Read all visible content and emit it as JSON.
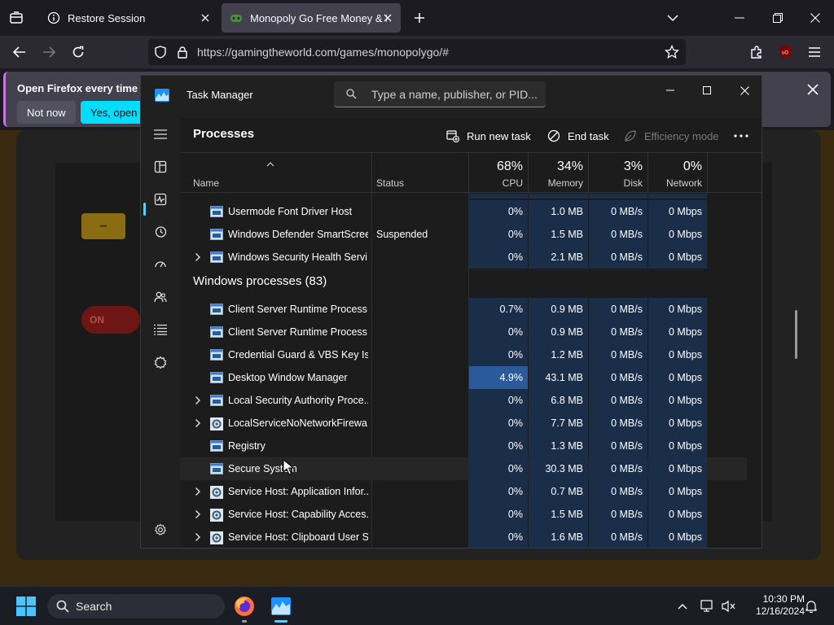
{
  "browser": {
    "tabs": [
      {
        "title": "Restore Session",
        "active": false
      },
      {
        "title": "Monopoly Go Free Money & R",
        "active": true
      }
    ],
    "url": "https://gamingtheworld.com/games/monopolygo/#",
    "notification": {
      "text": "Open Firefox every time yo",
      "not_now": "Not now",
      "yes_open": "Yes, open Fi"
    }
  },
  "page": {
    "minus_label": "–",
    "on_label": "ON"
  },
  "task_manager": {
    "title": "Task Manager",
    "search_placeholder": "Type a name, publisher, or PID...",
    "section_title": "Processes",
    "toolbar": {
      "run_new_task": "Run new task",
      "end_task": "End task",
      "efficiency_mode": "Efficiency mode"
    },
    "columns": {
      "name": "Name",
      "status": "Status",
      "cpu": {
        "pct": "68%",
        "label": "CPU"
      },
      "memory": {
        "pct": "34%",
        "label": "Memory"
      },
      "disk": {
        "pct": "3%",
        "label": "Disk"
      },
      "network": {
        "pct": "0%",
        "label": "Network"
      }
    },
    "top_rows": [
      {
        "name": "Usermode Font Driver Host",
        "status": "",
        "cpu": "0%",
        "memory": "1.0 MB",
        "disk": "0 MB/s",
        "network": "0 Mbps",
        "expandable": false,
        "icon": "window-icon"
      },
      {
        "name": "Windows Defender SmartScreen",
        "status": "Suspended",
        "cpu": "0%",
        "memory": "1.5 MB",
        "disk": "0 MB/s",
        "network": "0 Mbps",
        "expandable": false,
        "icon": "window-icon"
      },
      {
        "name": "Windows Security Health Servi...",
        "status": "",
        "cpu": "0%",
        "memory": "2.1 MB",
        "disk": "0 MB/s",
        "network": "0 Mbps",
        "expandable": true,
        "icon": "window-icon"
      }
    ],
    "group_title": "Windows processes (83)",
    "windows_rows": [
      {
        "name": "Client Server Runtime Process",
        "status": "",
        "cpu": "0.7%",
        "memory": "0.9 MB",
        "disk": "0 MB/s",
        "network": "0 Mbps",
        "expandable": false,
        "icon": "window-icon"
      },
      {
        "name": "Client Server Runtime Process",
        "status": "",
        "cpu": "0%",
        "memory": "0.9 MB",
        "disk": "0 MB/s",
        "network": "0 Mbps",
        "expandable": false,
        "icon": "window-icon"
      },
      {
        "name": "Credential Guard & VBS Key Is...",
        "status": "",
        "cpu": "0%",
        "memory": "1.2 MB",
        "disk": "0 MB/s",
        "network": "0 Mbps",
        "expandable": false,
        "icon": "window-icon"
      },
      {
        "name": "Desktop Window Manager",
        "status": "",
        "cpu": "4.9%",
        "memory": "43.1 MB",
        "disk": "0 MB/s",
        "network": "0 Mbps",
        "expandable": false,
        "icon": "window-icon",
        "hot": true
      },
      {
        "name": "Local Security Authority Proce...",
        "status": "",
        "cpu": "0%",
        "memory": "6.8 MB",
        "disk": "0 MB/s",
        "network": "0 Mbps",
        "expandable": true,
        "icon": "window-icon"
      },
      {
        "name": "LocalServiceNoNetworkFirewa...",
        "status": "",
        "cpu": "0%",
        "memory": "7.7 MB",
        "disk": "0 MB/s",
        "network": "0 Mbps",
        "expandable": true,
        "icon": "gear-icon"
      },
      {
        "name": "Registry",
        "status": "",
        "cpu": "0%",
        "memory": "1.3 MB",
        "disk": "0 MB/s",
        "network": "0 Mbps",
        "expandable": false,
        "icon": "window-icon"
      },
      {
        "name": "Secure System",
        "status": "",
        "cpu": "0%",
        "memory": "30.3 MB",
        "disk": "0 MB/s",
        "network": "0 Mbps",
        "expandable": false,
        "icon": "window-icon",
        "highlight": true
      },
      {
        "name": "Service Host: Application Infor...",
        "status": "",
        "cpu": "0%",
        "memory": "0.7 MB",
        "disk": "0 MB/s",
        "network": "0 Mbps",
        "expandable": true,
        "icon": "gear-icon"
      },
      {
        "name": "Service Host: Capability Acces...",
        "status": "",
        "cpu": "0%",
        "memory": "1.5 MB",
        "disk": "0 MB/s",
        "network": "0 Mbps",
        "expandable": true,
        "icon": "gear-icon"
      },
      {
        "name": "Service Host: Clipboard User S...",
        "status": "",
        "cpu": "0%",
        "memory": "1.6 MB",
        "disk": "0 MB/s",
        "network": "0 Mbps",
        "expandable": true,
        "icon": "gear-icon"
      }
    ]
  },
  "taskbar": {
    "search_label": "Search",
    "time": "10:30 PM",
    "date": "12/16/2024"
  },
  "colors": {
    "accent": "#60cdff",
    "cpu_cell": "#1b2e49",
    "cpu_hot": "#2a5a9a",
    "firefox_button": "#00ddff"
  }
}
